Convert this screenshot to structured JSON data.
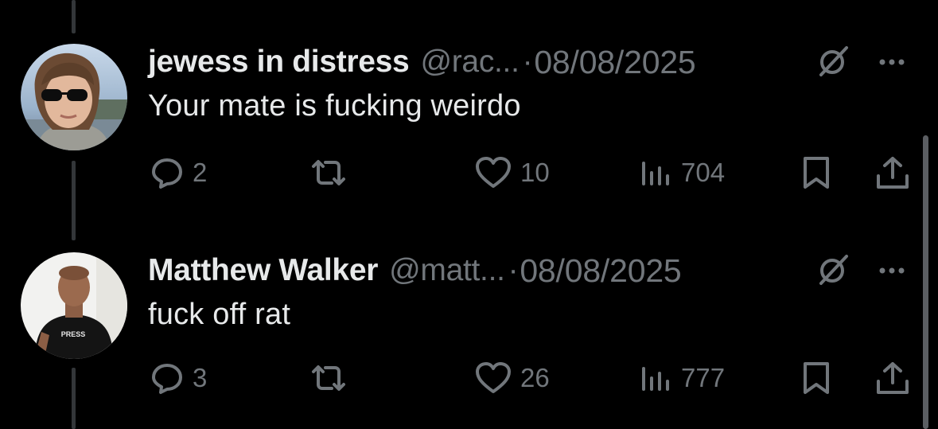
{
  "colors": {
    "background": "#000000",
    "text": "#e7e9ea",
    "muted": "#71767b",
    "thread_line": "#333639"
  },
  "tweets": [
    {
      "name": "jewess in distress",
      "handle": "@rac...",
      "separator": "·",
      "date": "08/08/2025",
      "text": "Your mate is fucking weirdo",
      "replies": "2",
      "likes": "10",
      "views": "704",
      "icons": [
        "reply-icon",
        "retweet-icon",
        "like-icon",
        "views-icon",
        "bookmark-icon",
        "share-icon",
        "grok-icon",
        "more-icon"
      ]
    },
    {
      "name": "Matthew Walker",
      "handle": "@matt...",
      "separator": "·",
      "date": "08/08/2025",
      "text": "fuck off rat",
      "replies": "3",
      "likes": "26",
      "views": "777",
      "avatar_shirt_text": "PRESS",
      "icons": [
        "reply-icon",
        "retweet-icon",
        "like-icon",
        "views-icon",
        "bookmark-icon",
        "share-icon",
        "grok-icon",
        "more-icon"
      ]
    }
  ]
}
